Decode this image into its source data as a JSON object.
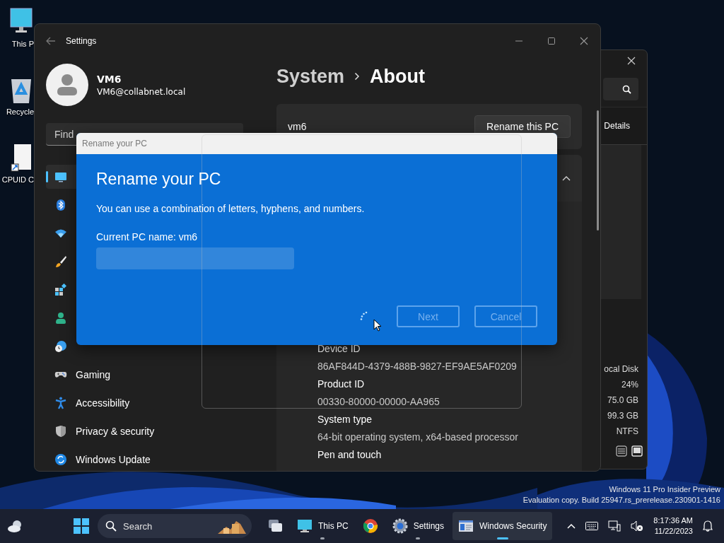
{
  "desktop": {
    "icons": [
      {
        "kind": "monitor",
        "label": "This P"
      },
      {
        "kind": "recycle",
        "label": "Recycle"
      },
      {
        "kind": "shortcut",
        "label": "CPUID C"
      }
    ],
    "watermark": [
      "Windows 11 Pro Insider Preview",
      "Evaluation copy. Build 25947.rs_prerelease.230901-1416"
    ]
  },
  "explorer_window": {
    "command": "Details",
    "drive": {
      "name": "ocal Disk",
      "values": [
        "24%",
        "75.0 GB",
        "99.3 GB",
        "NTFS"
      ]
    }
  },
  "settings_window": {
    "title": "Settings",
    "user": {
      "name": "VM6",
      "email": "VM6@collabnet.local"
    },
    "search": {
      "placeholder": "Find"
    },
    "nav": [
      {
        "kind": "system",
        "selected": true
      },
      {
        "kind": "bluetooth",
        "selected": false
      },
      {
        "kind": "network",
        "selected": false
      },
      {
        "kind": "personalization",
        "selected": false
      },
      {
        "kind": "apps",
        "selected": false
      },
      {
        "kind": "accounts",
        "selected": false
      },
      {
        "kind": "time",
        "selected": false
      },
      {
        "kind": "gaming",
        "label": "Gaming",
        "selected": false
      },
      {
        "kind": "accessibility",
        "label": "Accessibility",
        "selected": false
      },
      {
        "kind": "privacy",
        "label": "Privacy & security",
        "selected": false
      },
      {
        "kind": "update",
        "label": "Windows Update",
        "selected": false
      }
    ],
    "breadcrumb": [
      "System",
      "About"
    ],
    "device": {
      "name": "vm6",
      "rename_button": "Rename this PC"
    },
    "specs": [
      {
        "label": "Device ID",
        "value": "86AF844D-4379-488B-9827-EF9AE5AF0209"
      },
      {
        "label": "Product ID",
        "value": "00330-80000-00000-AA965"
      },
      {
        "label": "System type",
        "value": "64-bit operating system, x64-based processor"
      },
      {
        "label": "Pen and touch"
      }
    ]
  },
  "dialog": {
    "title": "Rename your PC",
    "heading": "Rename your PC",
    "description": "You can use a combination of letters, hyphens, and numbers.",
    "current_name": "Current PC name: vm6",
    "buttons": [
      {
        "label": "Next",
        "disabled": true
      },
      {
        "label": "Cancel",
        "disabled": true
      }
    ]
  },
  "taskbar": {
    "search": {
      "placeholder": "Search"
    },
    "apps": [
      {
        "kind": "task-view"
      },
      {
        "kind": "this-pc",
        "label": "This PC",
        "running": true,
        "active": false
      },
      {
        "kind": "chrome"
      },
      {
        "kind": "settings",
        "label": "Settings",
        "running": true,
        "active": false
      },
      {
        "kind": "security",
        "label": "Windows Security",
        "running": true,
        "active": true
      }
    ],
    "clock": {
      "time": "8:17:36 AM",
      "date": "11/22/2023"
    }
  }
}
